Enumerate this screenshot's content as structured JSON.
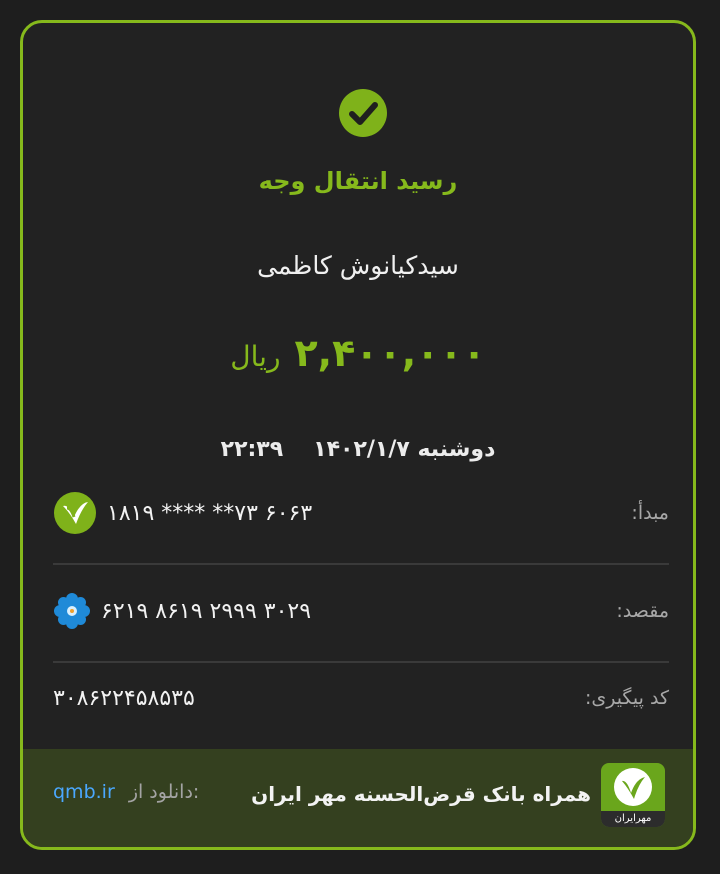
{
  "receipt": {
    "title": "رسید انتقال وجه",
    "recipient_name": "سیدکیانوش کاظمی",
    "amount": "۲,۴۰۰,۰۰۰",
    "currency": "ریال",
    "day": "دوشنبه",
    "date": "۱۴۰۲/۱/۷",
    "time": "۲۲:۳۹",
    "source_label": "مبدأ:",
    "source_card": "۱۸۱۹ **** **۷۳ ۶۰۶۳",
    "dest_label": "مقصد:",
    "dest_card": "۶۲۱۹ ۸۶۱۹ ۲۹۹۹ ۳۰۲۹",
    "tracking_label": "کد پیگیری:",
    "tracking_code": "۳۰۸۶۲۲۴۵۸۵۳۵"
  },
  "footer": {
    "app_name": "همراه بانک قرض‌الحسنه مهر ایران",
    "download_label": "دانلود از:",
    "download_url": "qmb.ir",
    "logo_text": "مهرایران"
  },
  "colors": {
    "accent": "#86b91c",
    "background": "#222222",
    "footer_bg": "#34401f",
    "link": "#4aa8ff"
  },
  "icons": {
    "status": "check-circle-icon",
    "source_bank": "mehr-iran-bank-icon",
    "dest_bank": "blue-flower-bank-icon"
  }
}
